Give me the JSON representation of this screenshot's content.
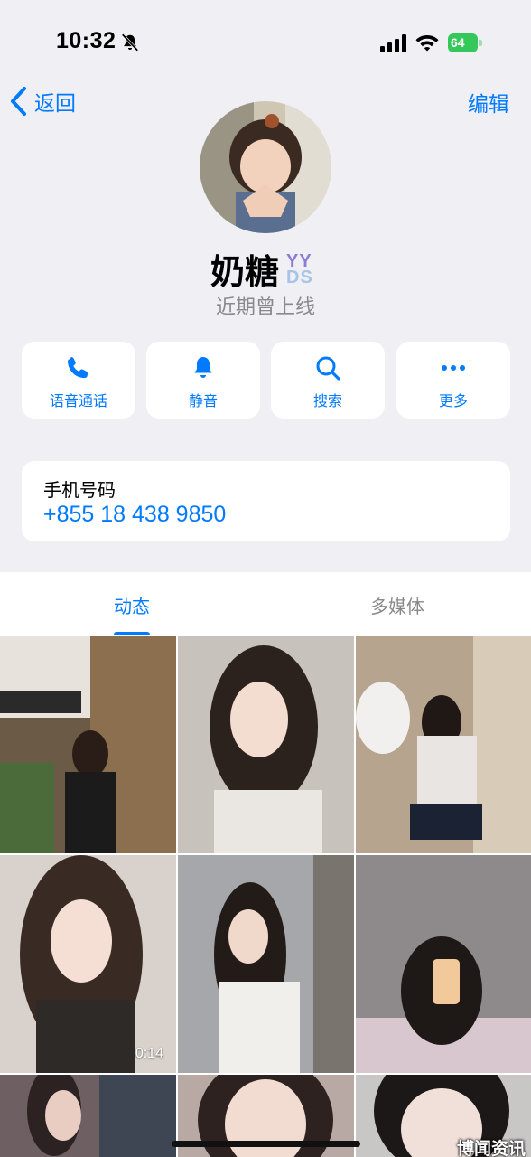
{
  "status_bar": {
    "time": "10:32",
    "battery": "64"
  },
  "nav": {
    "back_label": "返回",
    "edit_label": "编辑"
  },
  "profile": {
    "name": "奶糖",
    "badge_top": "YY",
    "badge_bottom": "DS",
    "last_seen": "近期曾上线"
  },
  "actions": [
    {
      "label": "语音通话",
      "icon": "phone-icon"
    },
    {
      "label": "静音",
      "icon": "bell-icon"
    },
    {
      "label": "搜索",
      "icon": "search-icon"
    },
    {
      "label": "更多",
      "icon": "more-icon"
    }
  ],
  "phone": {
    "label": "手机号码",
    "number": "+855 18 438 9850"
  },
  "tabs": [
    {
      "label": "动态",
      "active": true
    },
    {
      "label": "多媒体",
      "active": false
    }
  ],
  "media": {
    "video_duration": "0:14"
  },
  "watermark": "博闻资讯",
  "colors": {
    "accent": "#007aff",
    "background": "#efeff4",
    "battery": "#34c759",
    "secondary_text": "#8a8a8e"
  }
}
